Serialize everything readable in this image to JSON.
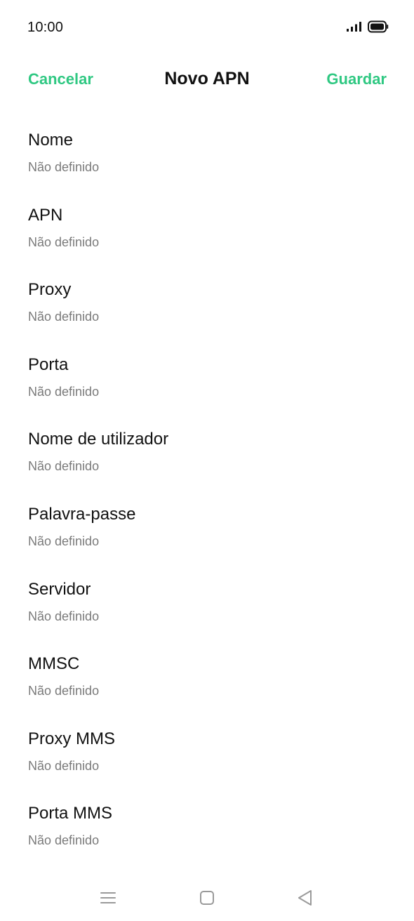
{
  "status_bar": {
    "time": "10:00",
    "signal_icon": "signal-icon",
    "battery_icon": "battery-icon"
  },
  "header": {
    "cancel_label": "Cancelar",
    "title": "Novo APN",
    "save_label": "Guardar"
  },
  "colors": {
    "accent": "#2fc882",
    "text_primary": "#111111",
    "text_secondary": "#7a7a7a",
    "nav_icon": "#9a9a9a"
  },
  "apn_fields": [
    {
      "label": "Nome",
      "value": "Não definido"
    },
    {
      "label": "APN",
      "value": "Não definido"
    },
    {
      "label": "Proxy",
      "value": "Não definido"
    },
    {
      "label": "Porta",
      "value": "Não definido"
    },
    {
      "label": "Nome de utilizador",
      "value": "Não definido"
    },
    {
      "label": "Palavra-passe",
      "value": "Não definido"
    },
    {
      "label": "Servidor",
      "value": "Não definido"
    },
    {
      "label": "MMSC",
      "value": "Não definido"
    },
    {
      "label": "Proxy MMS",
      "value": "Não definido"
    },
    {
      "label": "Porta MMS",
      "value": "Não definido"
    }
  ],
  "nav_bar": {
    "icons": [
      "menu-icon",
      "home-icon",
      "back-icon"
    ]
  }
}
